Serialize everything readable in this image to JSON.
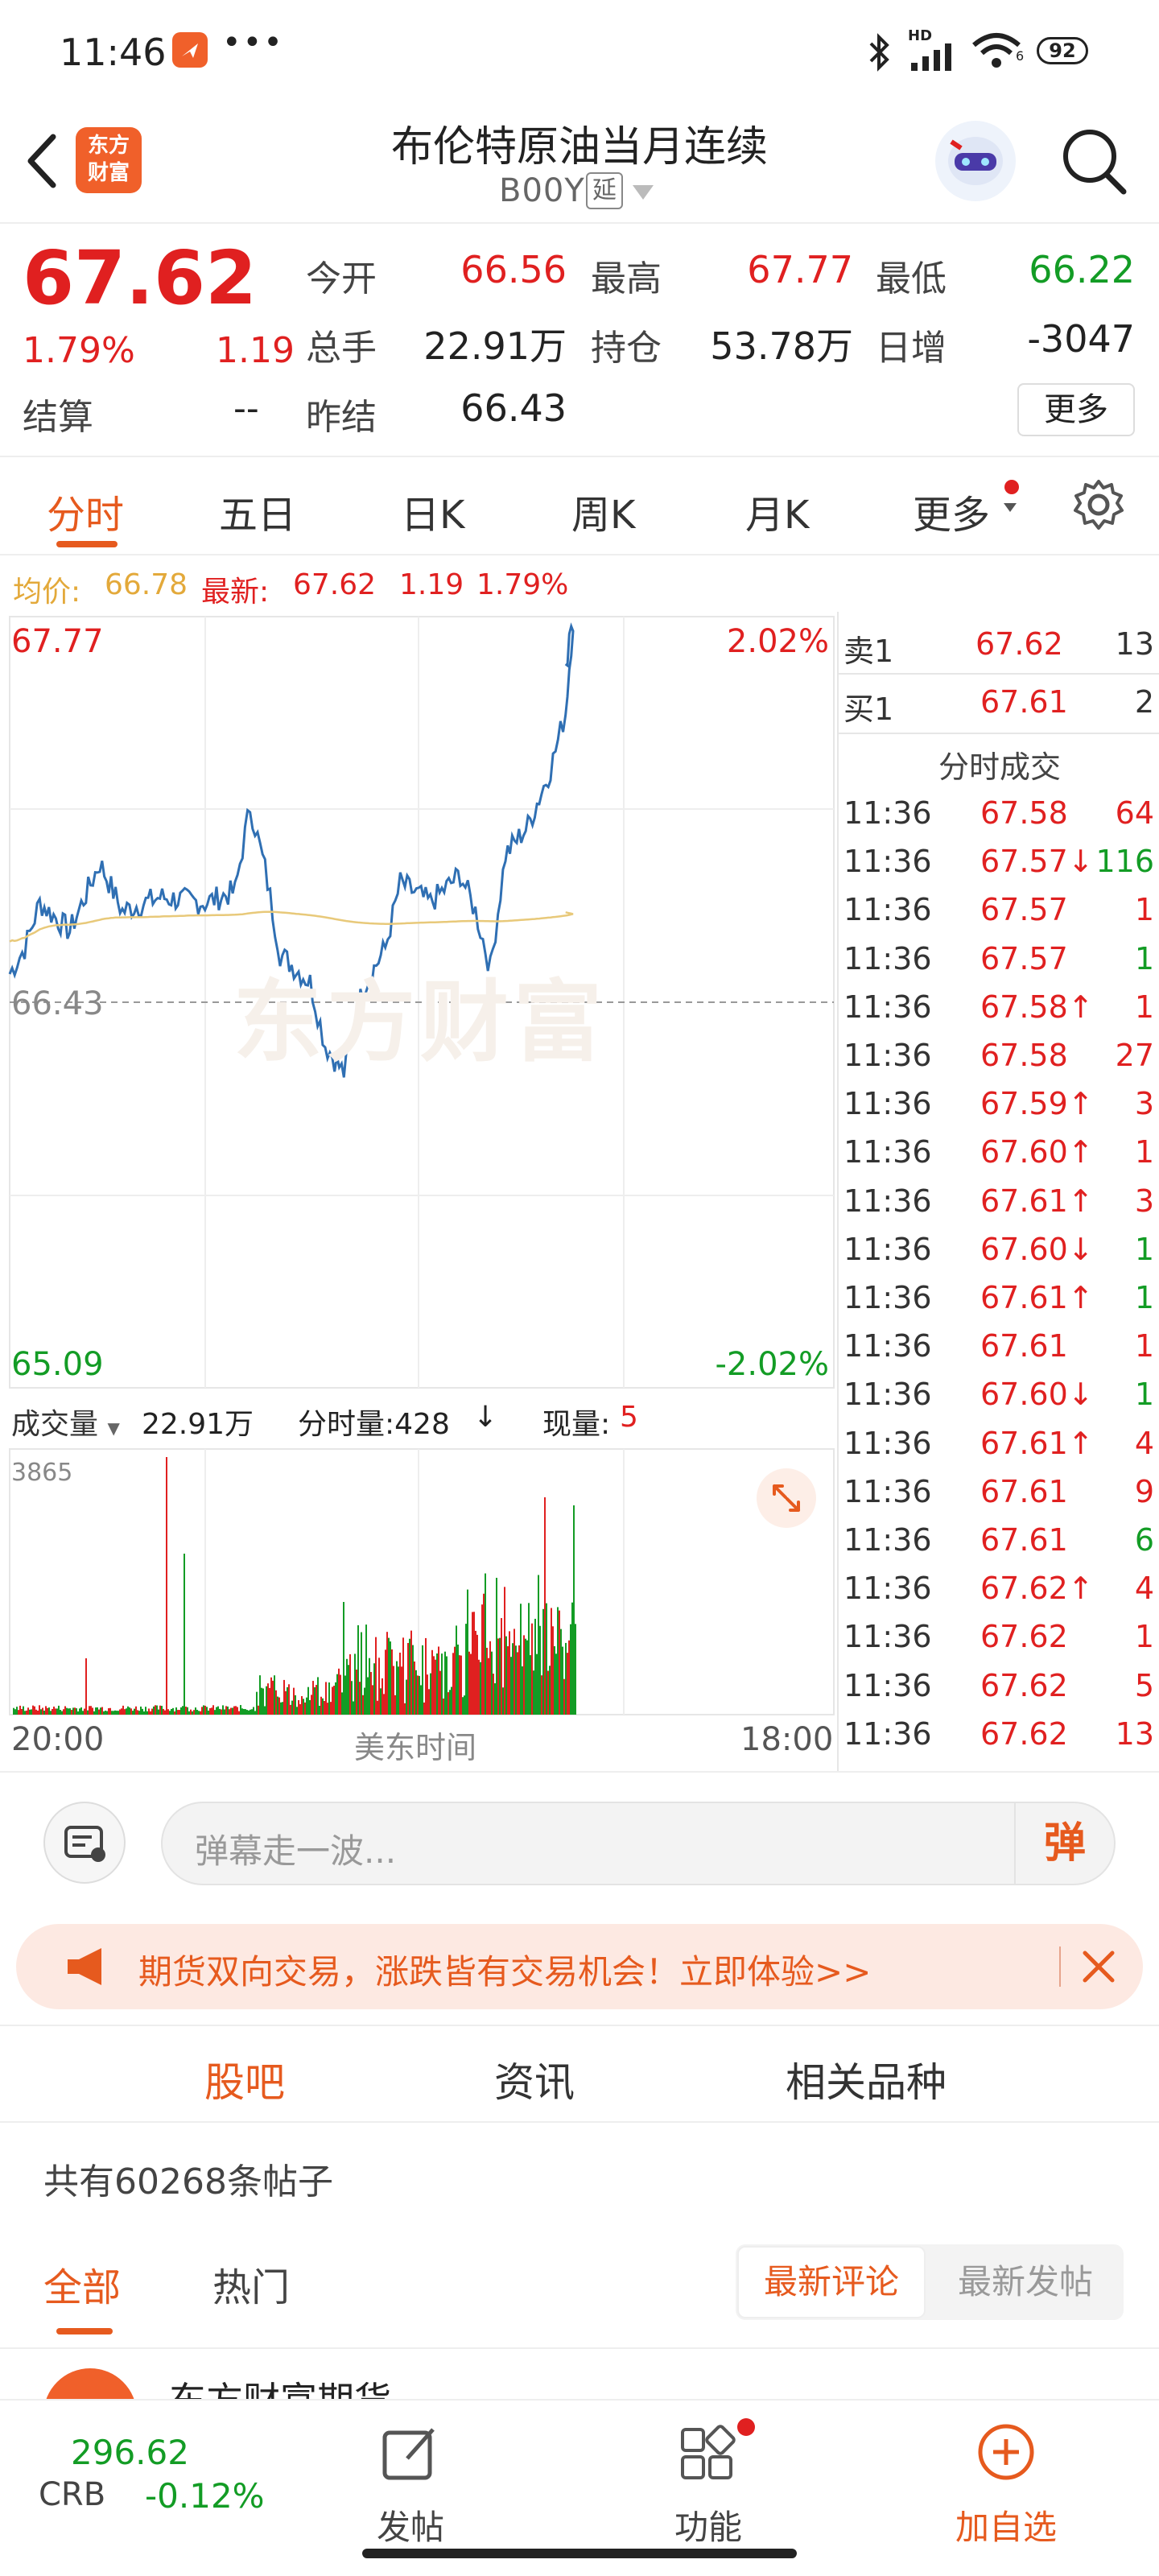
{
  "status": {
    "time": "11:46",
    "dots": "•••",
    "battery": "92",
    "signal_hd": "HD",
    "wifi_num": "6"
  },
  "header": {
    "title": "布伦特原油当月连续",
    "code": "B00Y",
    "badge": "延",
    "logo_top": "东方",
    "logo_bottom": "财富"
  },
  "quote": {
    "price": "67.62",
    "pct": "1.79%",
    "chg": "1.19",
    "open_label": "今开",
    "open": "66.56",
    "high_label": "最高",
    "high": "67.77",
    "low_label": "最低",
    "low": "66.22",
    "vol_label": "总手",
    "vol": "22.91万",
    "oi_label": "持仓",
    "oi": "53.78万",
    "daily_label": "日增",
    "daily": "-3047",
    "settle_label": "结算",
    "settle": "--",
    "prev_label": "昨结",
    "prev": "66.43",
    "more": "更多"
  },
  "tabs": [
    "分时",
    "五日",
    "日K",
    "周K",
    "月K",
    "更多"
  ],
  "legend": {
    "avg_label": "均价:",
    "avg": "66.78",
    "latest_label": "最新:",
    "latest": "67.62",
    "chg": "1.19",
    "pct": "1.79%"
  },
  "chart_labels": {
    "max": "67.77",
    "max_pct": "2.02%",
    "mid": "66.43",
    "min": "65.09",
    "min_pct": "-2.02%",
    "watermark": "东方财富",
    "vol_label": "成交量",
    "vol_total": "22.91万",
    "tick_label": "分时量:428",
    "tick_arrow": "↓",
    "now_label": "现量:",
    "now": "5",
    "vol_max": "3865",
    "x_start": "20:00",
    "x_mid": "美东时间",
    "x_end": "18:00"
  },
  "chart_data": {
    "type": "line",
    "y_range": [
      65.09,
      67.77
    ],
    "prev_settle": 66.43,
    "series": [
      {
        "name": "最新",
        "color": "#2f6fb3"
      },
      {
        "name": "均价",
        "color": "#e8c97a"
      }
    ],
    "colors": {
      "up": "#e02020",
      "down": "#139c25"
    }
  },
  "orderbook": {
    "sell_label": "卖1",
    "sell_price": "67.62",
    "sell_vol": "13",
    "buy_label": "买1",
    "buy_price": "67.61",
    "buy_vol": "2",
    "title": "分时成交",
    "ticks": [
      {
        "t": "11:36",
        "p": "67.58",
        "a": "",
        "v": "64",
        "c": "r"
      },
      {
        "t": "11:36",
        "p": "67.57",
        "a": "↓",
        "v": "116",
        "c": "g"
      },
      {
        "t": "11:36",
        "p": "67.57",
        "a": "",
        "v": "1",
        "c": "r"
      },
      {
        "t": "11:36",
        "p": "67.57",
        "a": "",
        "v": "1",
        "c": "g"
      },
      {
        "t": "11:36",
        "p": "67.58",
        "a": "↑",
        "v": "1",
        "c": "r"
      },
      {
        "t": "11:36",
        "p": "67.58",
        "a": "",
        "v": "27",
        "c": "r"
      },
      {
        "t": "11:36",
        "p": "67.59",
        "a": "↑",
        "v": "3",
        "c": "r"
      },
      {
        "t": "11:36",
        "p": "67.60",
        "a": "↑",
        "v": "1",
        "c": "r"
      },
      {
        "t": "11:36",
        "p": "67.61",
        "a": "↑",
        "v": "3",
        "c": "r"
      },
      {
        "t": "11:36",
        "p": "67.60",
        "a": "↓",
        "v": "1",
        "c": "g"
      },
      {
        "t": "11:36",
        "p": "67.61",
        "a": "↑",
        "v": "1",
        "c": "g"
      },
      {
        "t": "11:36",
        "p": "67.61",
        "a": "",
        "v": "1",
        "c": "r"
      },
      {
        "t": "11:36",
        "p": "67.60",
        "a": "↓",
        "v": "1",
        "c": "g"
      },
      {
        "t": "11:36",
        "p": "67.61",
        "a": "↑",
        "v": "4",
        "c": "r"
      },
      {
        "t": "11:36",
        "p": "67.61",
        "a": "",
        "v": "9",
        "c": "r"
      },
      {
        "t": "11:36",
        "p": "67.61",
        "a": "",
        "v": "6",
        "c": "g"
      },
      {
        "t": "11:36",
        "p": "67.62",
        "a": "↑",
        "v": "4",
        "c": "r"
      },
      {
        "t": "11:36",
        "p": "67.62",
        "a": "",
        "v": "1",
        "c": "r"
      },
      {
        "t": "11:36",
        "p": "67.62",
        "a": "",
        "v": "5",
        "c": "r"
      },
      {
        "t": "11:36",
        "p": "67.62",
        "a": "",
        "v": "13",
        "c": "r"
      }
    ]
  },
  "bullet": {
    "placeholder": "弹幕走一波...",
    "btn": "弹"
  },
  "ad": {
    "text": "期货双向交易，涨跌皆有交易机会！立即体验>>"
  },
  "subnav": [
    "股吧",
    "资讯",
    "相关品种"
  ],
  "posts": {
    "count_text": "共有60268条帖子",
    "tab_all": "全部",
    "tab_hot": "热门",
    "sort_comment": "最新评论",
    "sort_post": "最新发帖",
    "preview": "东方财富期货"
  },
  "bottom": {
    "crb_value": "296.62",
    "crb_label": "CRB",
    "crb_pct": "-0.12%",
    "post": "发帖",
    "func": "功能",
    "add": "加自选"
  }
}
